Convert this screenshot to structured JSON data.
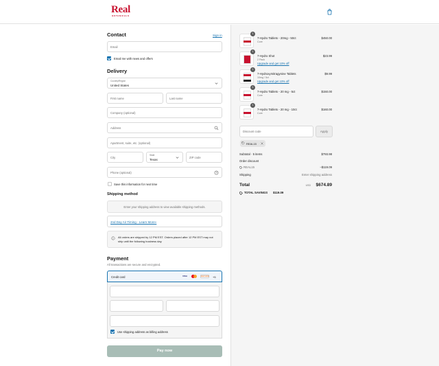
{
  "brand": {
    "name": "Real",
    "tagline": "BOTANICALS"
  },
  "contact": {
    "title": "Contact",
    "sign_in": "Sign in",
    "email_placeholder": "Email",
    "news_label": "Email me with news and offers"
  },
  "delivery": {
    "title": "Delivery",
    "country_label": "Country/Region",
    "country_value": "United States",
    "first_name": "First name",
    "last_name": "Last name",
    "company": "Company (optional)",
    "address": "Address",
    "apartment": "Apartment, suite, etc. (optional)",
    "city": "City",
    "state_label": "State",
    "state_value": "Texas",
    "zip": "ZIP code",
    "phone": "Phone (optional)",
    "save_info": "Save this information for next time"
  },
  "shipping": {
    "title": "Shipping method",
    "notice": "Enter your shipping address to view available shipping methods.",
    "air_link": "2nd Day Air Timing - Learn More»",
    "info": "All orders are shipped by 12 PM EST. Orders placed after 12 PM EST may not ship until the following business day."
  },
  "payment": {
    "title": "Payment",
    "subtitle": "All transactions are secure and encrypted.",
    "method": "Credit card",
    "cards": [
      "VISA",
      "MC",
      "DISCOVER"
    ],
    "more_cards": "+5",
    "billing_label": "Use shipping address as billing address",
    "pay_button": "Pay now"
  },
  "cart": {
    "items": [
      {
        "qty": "1",
        "name": "7-Hydro Tablets - 20mg - 50ct",
        "variant": "Core",
        "price": "$450.00",
        "upsell": ""
      },
      {
        "qty": "1",
        "name": "7-Hydro Shot",
        "variant": "2 Pack",
        "price": "$23.99",
        "upsell": "Upgrade and get 10% off"
      },
      {
        "qty": "1",
        "name": "7-Hydroxymitragynine Tablets",
        "variant": "10mg / 5ct",
        "price": "$9.99",
        "upsell": "Upgrade and get 10% off"
      },
      {
        "qty": "1",
        "name": "7-Hydro Tablets - 20 mg - 5ct",
        "variant": "Core",
        "price": "$150.00",
        "upsell": ""
      },
      {
        "qty": "1",
        "name": "7-Hydro Tablets - 20 mg - 10ct",
        "variant": "Core",
        "price": "$160.00",
        "upsell": ""
      }
    ],
    "discount_placeholder": "Discount code",
    "apply": "Apply",
    "code_tag": "REAL15",
    "subtotal_label": "Subtotal · 5 items",
    "subtotal_value": "$793.98",
    "order_discount_label": "Order discount",
    "discount_code": "REAL15",
    "discount_value": "−$119.09",
    "shipping_label": "Shipping",
    "shipping_value": "Enter shipping address",
    "total_label": "Total",
    "currency": "USD",
    "total_value": "$674.89",
    "savings_label": "TOTAL SAVINGS",
    "savings_value": "$119.09"
  },
  "colors": {
    "accent": "#1773b0",
    "brand": "#c8102e",
    "pay_button": "#a8bdb6"
  }
}
